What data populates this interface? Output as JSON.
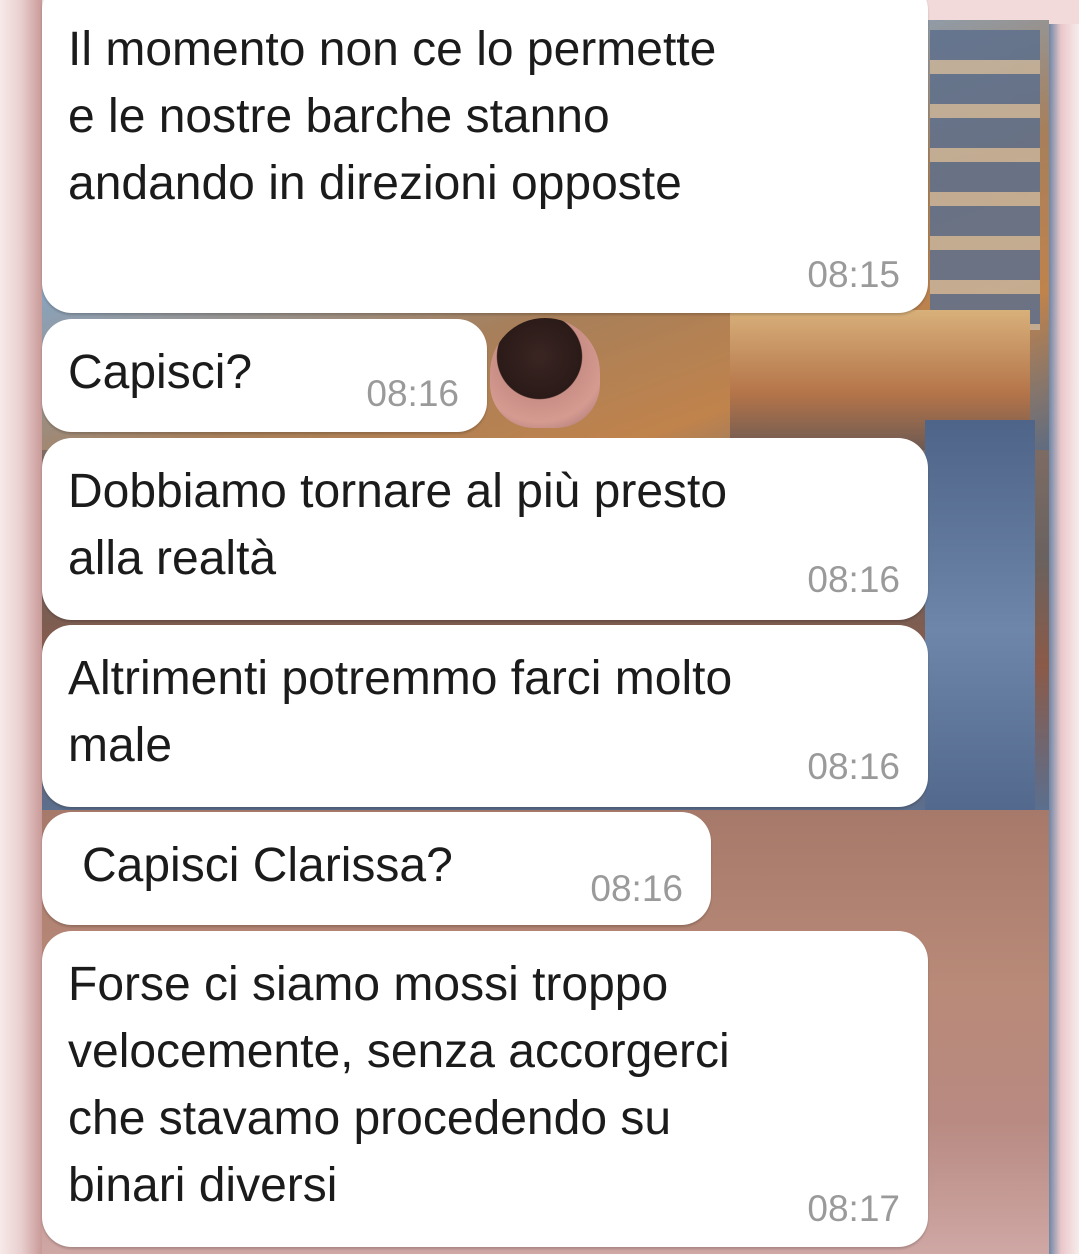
{
  "chat": {
    "messages": [
      {
        "text": "Il momento non ce lo permette\ne le nostre barche stanno\nandando in direzioni opposte",
        "time": "08:15"
      },
      {
        "text": "Capisci?",
        "time": "08:16"
      },
      {
        "text": "Dobbiamo tornare al più presto\nalla realtà",
        "time": "08:16"
      },
      {
        "text": "Altrimenti potremmo farci molto\nmale",
        "time": "08:16"
      },
      {
        "text": "Capisci Clarissa?",
        "time": "08:16"
      },
      {
        "text": "Forse ci siamo mossi troppo\nvelocemente, senza accorgerci\nche stavamo procedendo su\nbinari diversi",
        "time": "08:17"
      }
    ]
  },
  "colors": {
    "bubble_background": "#ffffff",
    "message_text": "#1b1b1b",
    "timestamp_text": "#9a9a9a"
  }
}
